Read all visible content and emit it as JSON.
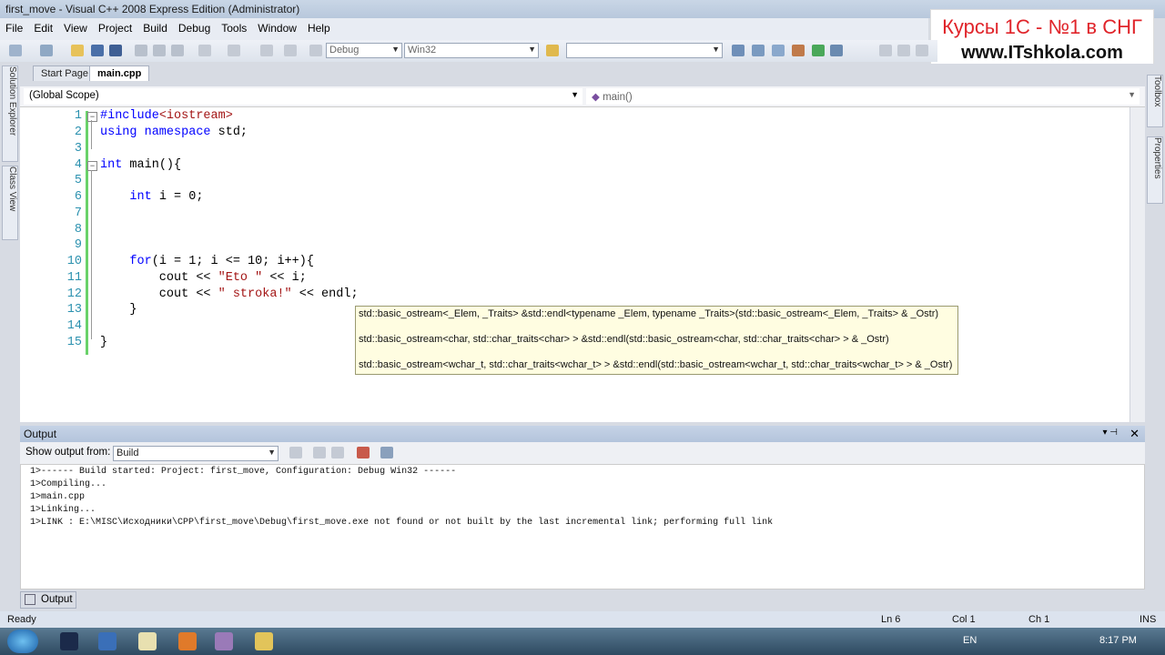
{
  "window": {
    "title": "first_move - Visual C++ 2008 Express Edition (Administrator)"
  },
  "watermark": {
    "line1": "Курсы 1С - №1 в СНГ",
    "line2": "www.ITshkola.com"
  },
  "menu": [
    "File",
    "Edit",
    "View",
    "Project",
    "Build",
    "Debug",
    "Tools",
    "Window",
    "Help"
  ],
  "toolbar": {
    "config": "Debug",
    "platform": "Win32"
  },
  "side_tabs": {
    "left": [
      "Solution Explorer",
      "Class View"
    ],
    "right": [
      "Toolbox",
      "Properties"
    ]
  },
  "tabs": {
    "start": "Start Page",
    "main": "main.cpp"
  },
  "scope": {
    "left": "(Global Scope)",
    "right": "main()"
  },
  "code_lines": [
    {
      "n": "1",
      "text": "#include<iostream>"
    },
    {
      "n": "2",
      "text": "using namespace std;"
    },
    {
      "n": "3",
      "text": ""
    },
    {
      "n": "4",
      "text": "int main(){"
    },
    {
      "n": "5",
      "text": ""
    },
    {
      "n": "6",
      "text": "    int i = 0;"
    },
    {
      "n": "7",
      "text": ""
    },
    {
      "n": "8",
      "text": ""
    },
    {
      "n": "9",
      "text": ""
    },
    {
      "n": "10",
      "text": "    for(i = 1; i <= 10; i++){"
    },
    {
      "n": "11",
      "text": "        cout << \"Eto \" << i;"
    },
    {
      "n": "12",
      "text": "        cout << \" stroka!\" << endl;"
    },
    {
      "n": "13",
      "text": "    }"
    },
    {
      "n": "14",
      "text": ""
    },
    {
      "n": "15",
      "text": "}"
    }
  ],
  "intellisense": [
    "std::basic_ostream<_Elem, _Traits> &std::endl<typename _Elem, typename _Traits>(std::basic_ostream<_Elem, _Traits> & _Ostr)",
    "std::basic_ostream<char, std::char_traits<char> > &std::endl(std::basic_ostream<char, std::char_traits<char> > & _Ostr)",
    "std::basic_ostream<wchar_t, std::char_traits<wchar_t> > &std::endl(std::basic_ostream<wchar_t, std::char_traits<wchar_t> > & _Ostr)"
  ],
  "output": {
    "title": "Output",
    "show_from_label": "Show output from:",
    "source": "Build",
    "lines": [
      "1>------ Build started: Project: first_move, Configuration: Debug Win32 ------",
      "1>Compiling...",
      "1>main.cpp",
      "1>Linking...",
      "1>LINK : E:\\MISC\\Исходники\\CPP\\first_move\\Debug\\first_move.exe not found or not built by the last incremental link; performing full link"
    ],
    "tab": "Output"
  },
  "status": {
    "ready": "Ready",
    "ln": "Ln 6",
    "col": "Col 1",
    "ch": "Ch 1",
    "ins": "INS"
  },
  "taskbar": {
    "lang": "EN",
    "time": "8:17 PM"
  }
}
